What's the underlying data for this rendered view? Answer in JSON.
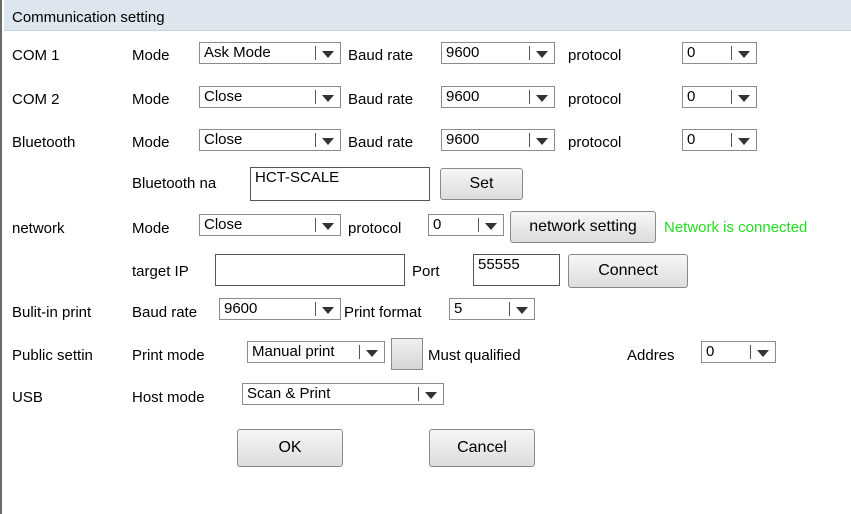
{
  "title": "Communication setting",
  "com1": {
    "label": "COM 1",
    "mode_label": "Mode",
    "mode": "Ask Mode",
    "baud_label": "Baud rate",
    "baud": "9600",
    "protocol_label": "protocol",
    "protocol": "0"
  },
  "com2": {
    "label": "COM 2",
    "mode_label": "Mode",
    "mode": "Close",
    "baud_label": "Baud rate",
    "baud": "9600",
    "protocol_label": "protocol",
    "protocol": "0"
  },
  "bluetooth": {
    "label": "Bluetooth",
    "mode_label": "Mode",
    "mode": "Close",
    "baud_label": "Baud rate",
    "baud": "9600",
    "protocol_label": "protocol",
    "protocol": "0",
    "name_label": "Bluetooth na",
    "name_value": "HCT-SCALE",
    "set_label": "Set"
  },
  "network": {
    "label": "network",
    "mode_label": "Mode",
    "mode": "Close",
    "protocol_label": "protocol",
    "protocol": "0",
    "setting_button": "network setting",
    "status": "Network is connected",
    "status_color": "#22dd22",
    "target_ip_label": "target IP",
    "target_ip_value": "",
    "port_label": "Port",
    "port_value": "55555",
    "connect_label": "Connect"
  },
  "builtin_print": {
    "label": "Bulit-in print",
    "baud_label": "Baud rate",
    "baud": "9600",
    "format_label": "Print format",
    "format": "5"
  },
  "public_setting": {
    "label": "Public settin",
    "print_mode_label": "Print mode",
    "print_mode": "Manual print",
    "must_qualified_label": "Must qualified",
    "must_qualified_checked": false,
    "address_label": "Addres",
    "address": "0"
  },
  "usb": {
    "label": "USB",
    "host_mode_label": "Host mode",
    "host_mode": "Scan & Print"
  },
  "buttons": {
    "ok": "OK",
    "cancel": "Cancel"
  }
}
